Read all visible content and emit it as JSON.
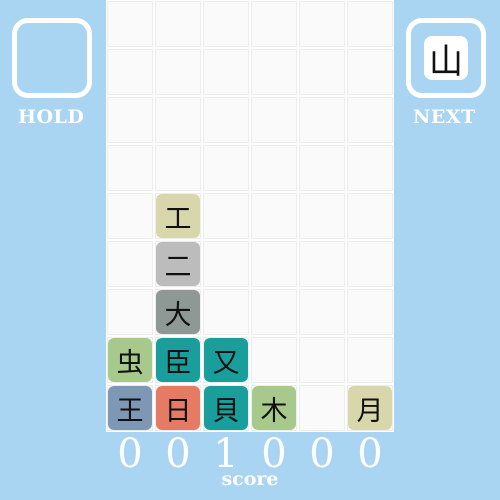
{
  "hold": {
    "label": "HOLD"
  },
  "next": {
    "label": "NEXT",
    "piece": "山"
  },
  "score": {
    "label": "score",
    "digits": [
      "0",
      "0",
      "1",
      "0",
      "0",
      "0"
    ]
  },
  "colors": {
    "background": "#a9d4f2",
    "tile_khaki": "#d8d6ab",
    "tile_gray": "#bcbcbc",
    "tile_darkgray": "#8e9996",
    "tile_teal": "#1a9e9c",
    "tile_green": "#a7c98c",
    "tile_slate": "#7e97b4",
    "tile_salmon": "#e57b64"
  },
  "board": {
    "cols": 6,
    "rows": 9,
    "tiles": [
      {
        "char": "工",
        "col": 1,
        "row": 4,
        "color": "#d8d6ab"
      },
      {
        "char": "二",
        "col": 1,
        "row": 5,
        "color": "#bcbcbc"
      },
      {
        "char": "大",
        "col": 1,
        "row": 6,
        "color": "#8e9996"
      },
      {
        "char": "虫",
        "col": 0,
        "row": 7,
        "color": "#a7c98c"
      },
      {
        "char": "臣",
        "col": 1,
        "row": 7,
        "color": "#1a9e9c"
      },
      {
        "char": "又",
        "col": 2,
        "row": 7,
        "color": "#1a9e9c"
      },
      {
        "char": "王",
        "col": 0,
        "row": 8,
        "color": "#7e97b4"
      },
      {
        "char": "日",
        "col": 1,
        "row": 8,
        "color": "#e57b64"
      },
      {
        "char": "貝",
        "col": 2,
        "row": 8,
        "color": "#1a9e9c"
      },
      {
        "char": "木",
        "col": 3,
        "row": 8,
        "color": "#a7c98c"
      },
      {
        "char": "月",
        "col": 5,
        "row": 8,
        "color": "#d8d6ab"
      }
    ]
  }
}
